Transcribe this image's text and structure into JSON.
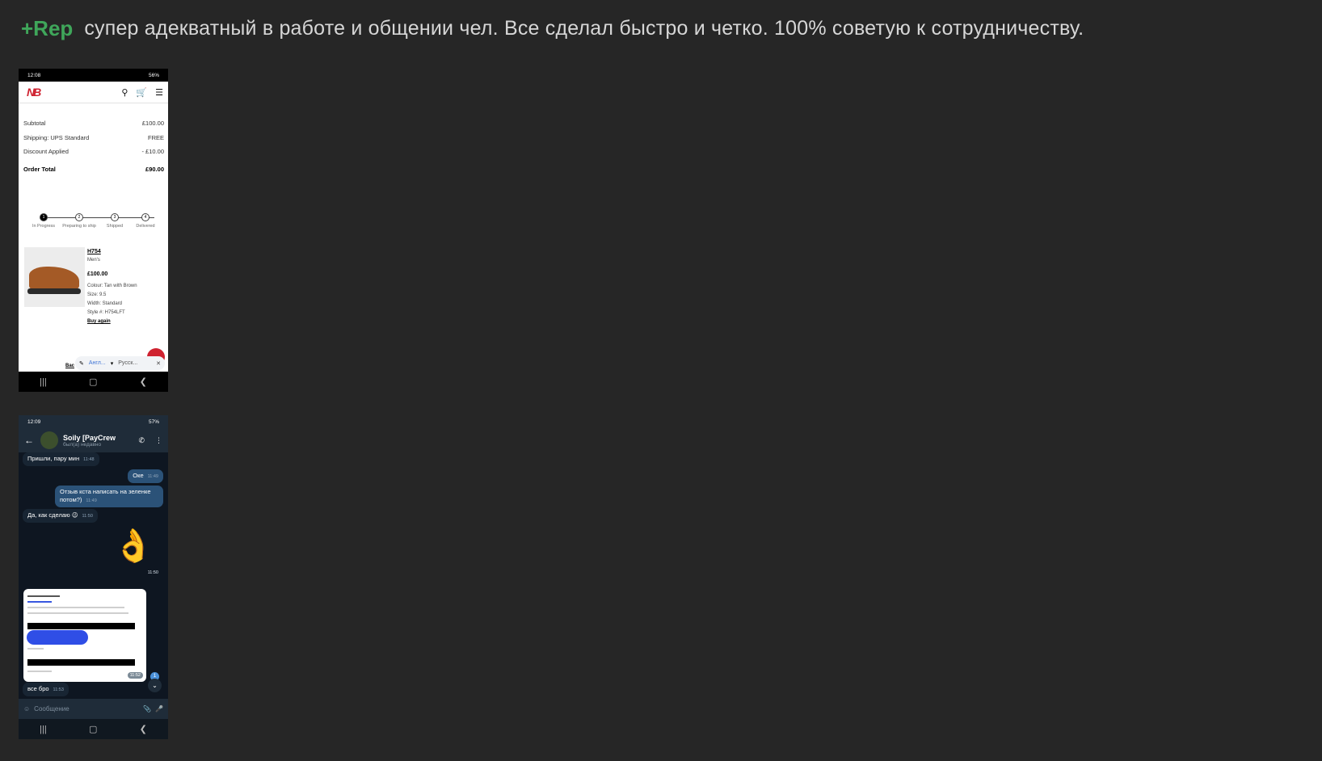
{
  "post": {
    "rep_label": "+Rep",
    "review_text": "супер адекватный в работе и общении чел. Все сделал быстро и четко. 100% советую к сотрудничеству."
  },
  "shot1": {
    "status_time": "12:08",
    "status_right": "56%",
    "brand": "NB",
    "rows": [
      {
        "label": "Subtotal",
        "value": "£100.00"
      },
      {
        "label": "Shipping: UPS Standard",
        "value": "FREE"
      },
      {
        "label": "Discount Applied",
        "value": "- £10.00"
      }
    ],
    "total": {
      "label": "Order Total",
      "value": "£90.00"
    },
    "steps": [
      {
        "num": "1",
        "label": "In Progress"
      },
      {
        "num": "2",
        "label": "Preparing to ship"
      },
      {
        "num": "3",
        "label": "Shipped"
      },
      {
        "num": "4",
        "label": "Delivered"
      }
    ],
    "product": {
      "name": "H754",
      "gender": "Men's",
      "price": "£100.00",
      "colour": "Colour: Tan with Brown",
      "size": "Size: 9.5",
      "width": "Width: Standard",
      "style": "Style #: H754LFT",
      "buy_again": "Buy again"
    },
    "back_link": "Bac",
    "translate": {
      "from": "Англ...",
      "to": "Русск..."
    }
  },
  "shot2": {
    "status_time": "12:09",
    "status_right": "57%",
    "contact_name": "Soily [PayCrew",
    "contact_status": "был(а) недавно",
    "messages": [
      {
        "text": "Пришли, пару мин",
        "time": "11:48"
      },
      {
        "text": "Оке",
        "time": "11:49"
      },
      {
        "text": "Отзыв кста написать на зеленке потом?)",
        "time": "11:49"
      },
      {
        "text": "Да, как сделаю 😉",
        "time": "11:50"
      },
      {
        "text": "👌",
        "time": "11:50"
      },
      {
        "text": "все бро",
        "time": "11:53"
      }
    ],
    "doc_time": "11:52",
    "unread": "1",
    "composer_placeholder": "Сообщение"
  }
}
